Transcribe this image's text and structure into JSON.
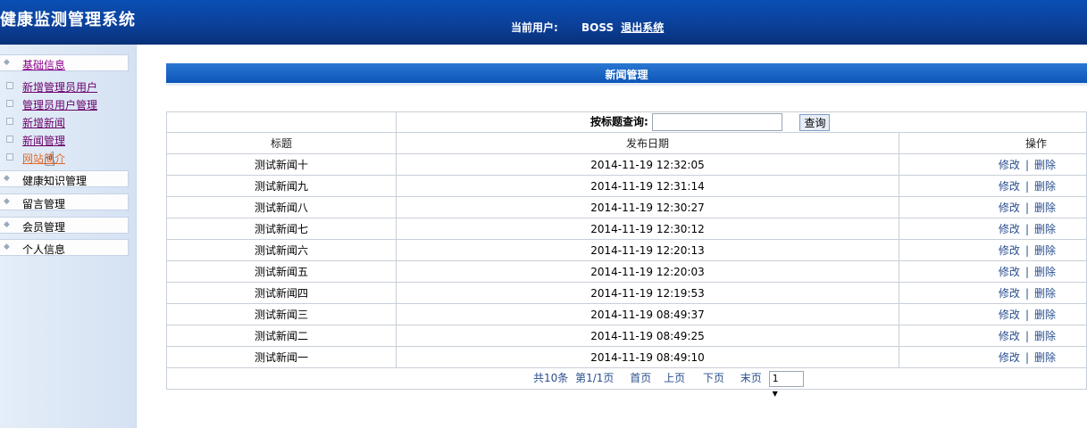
{
  "header": {
    "app_title": "健康监测管理系统",
    "user_label": "当前用户:",
    "user_name": "BOSS",
    "logout": "退出系统"
  },
  "sidebar": {
    "menus": [
      {
        "label": "基础信息",
        "active": true
      },
      {
        "label": "健康知识管理"
      },
      {
        "label": "留言管理"
      },
      {
        "label": "会员管理"
      },
      {
        "label": "个人信息"
      }
    ],
    "sub_items": [
      {
        "label": "新增管理员用户"
      },
      {
        "label": "管理员用户管理"
      },
      {
        "label": "新增新闻"
      },
      {
        "label": "新闻管理"
      },
      {
        "label": "网站简介"
      }
    ]
  },
  "panel": {
    "title": "新闻管理"
  },
  "search": {
    "label": "按标题查询:",
    "value": "",
    "button": "查询"
  },
  "table": {
    "headers": [
      "标题",
      "发布日期",
      "操作"
    ],
    "edit_label": "修改",
    "sep": "|",
    "delete_label": "删除",
    "rows": [
      {
        "title": "测试新闻十",
        "date": "2014-11-19 12:32:05"
      },
      {
        "title": "测试新闻九",
        "date": "2014-11-19 12:31:14"
      },
      {
        "title": "测试新闻八",
        "date": "2014-11-19 12:30:27"
      },
      {
        "title": "测试新闻七",
        "date": "2014-11-19 12:30:12"
      },
      {
        "title": "测试新闻六",
        "date": "2014-11-19 12:20:13"
      },
      {
        "title": "测试新闻五",
        "date": "2014-11-19 12:20:03"
      },
      {
        "title": "测试新闻四",
        "date": "2014-11-19 12:19:53"
      },
      {
        "title": "测试新闻三",
        "date": "2014-11-19 08:49:37"
      },
      {
        "title": "测试新闻二",
        "date": "2014-11-19 08:49:25"
      },
      {
        "title": "测试新闻一",
        "date": "2014-11-19 08:49:10"
      }
    ]
  },
  "pager": {
    "total": "共10条",
    "page_info": "第1/1页",
    "first": "首页",
    "prev": "上页",
    "next": "下页",
    "last": "末页",
    "current": "1"
  }
}
